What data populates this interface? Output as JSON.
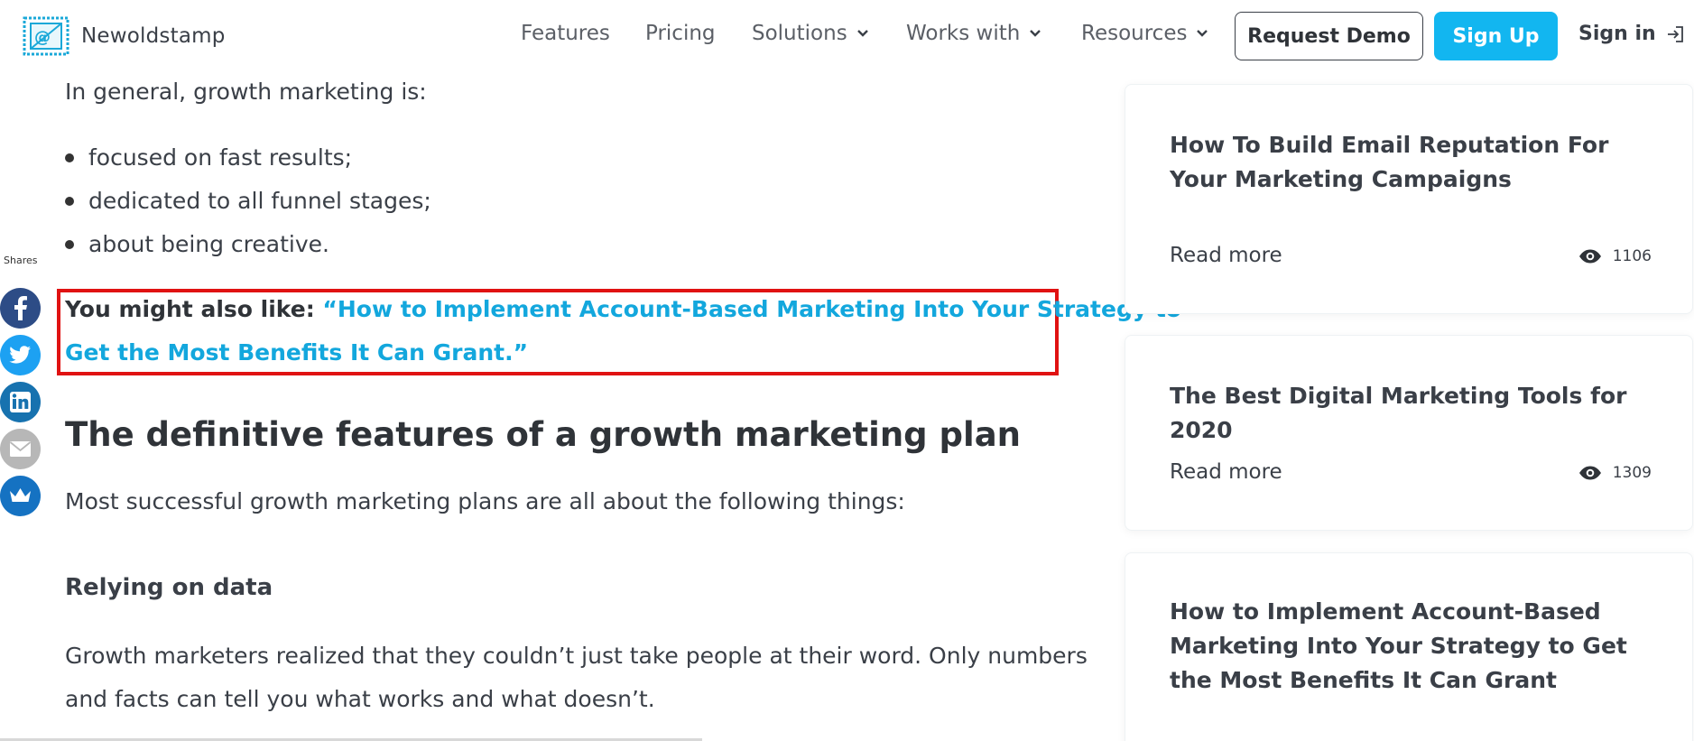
{
  "header": {
    "brand": "Newoldstamp",
    "nav": [
      {
        "label": "Features",
        "dropdown": false
      },
      {
        "label": "Pricing",
        "dropdown": false
      },
      {
        "label": "Solutions",
        "dropdown": true
      },
      {
        "label": "Works with",
        "dropdown": true
      },
      {
        "label": "Resources",
        "dropdown": true
      }
    ],
    "request_demo": "Request Demo",
    "sign_up": "Sign Up",
    "sign_in": "Sign in"
  },
  "share_bar": {
    "label": "Shares",
    "icons": [
      "facebook-icon",
      "twitter-icon",
      "linkedin-icon",
      "email-icon",
      "crown-icon"
    ]
  },
  "article": {
    "intro": "In general, growth marketing is:",
    "bullets": [
      "focused on fast results;",
      "dedicated to all funnel stages;",
      "about being creative."
    ],
    "callout": {
      "prefix": "You might also like:",
      "link_line1": "“How to Implement Account-Based Marketing Into Your Strategy to",
      "link_line2": "Get the Most Benefits It Can Grant.”"
    },
    "heading": "The definitive features of a growth marketing plan",
    "heading_intro": "Most successful growth marketing plans are all about the following things:",
    "subheading": "Relying on data",
    "body_line1": "Growth marketers realized that they couldn’t just take people at their word. Only numbers",
    "body_line2": "and facts can tell you what works and what doesn’t."
  },
  "sidebar": {
    "cards": [
      {
        "title": "How To Build Email Reputation For Your Marketing Campaigns",
        "read_more": "Read more",
        "views": "1106"
      },
      {
        "title": "The Best Digital Marketing Tools for 2020",
        "read_more": "Read more",
        "views": "1309"
      },
      {
        "title": "How to Implement Account-Based Marketing Into Your Strategy to Get the Most Benefits It Can Grant",
        "read_more": "",
        "views": ""
      }
    ]
  },
  "colors": {
    "accent": "#12b6f0",
    "link": "#13a7dd",
    "highlight_border": "#e01212",
    "text": "#3a3f47"
  }
}
